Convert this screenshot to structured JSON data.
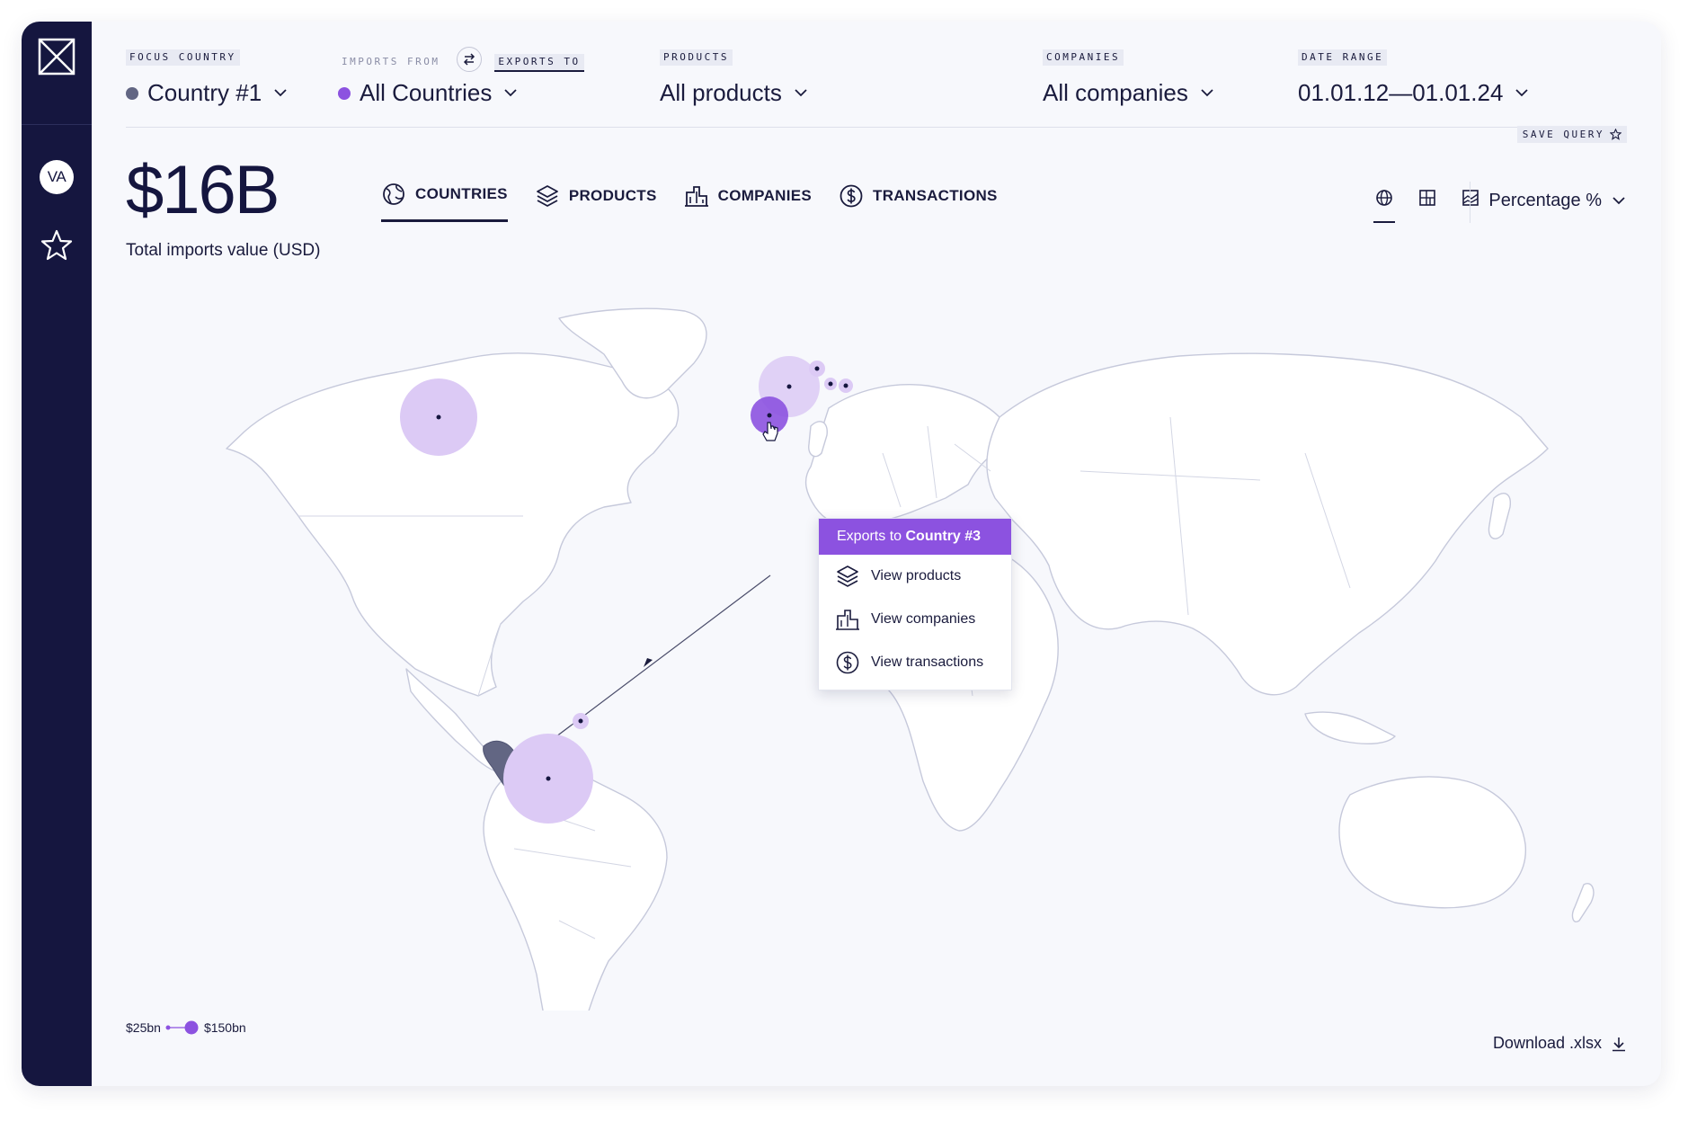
{
  "sidebar": {
    "logo_icon": "app-logo-icon",
    "avatar_initials": "VA",
    "favorites_icon": "star-icon"
  },
  "filters": {
    "focus_country": {
      "label": "FOCUS COUNTRY",
      "value": "Country #1",
      "dot_color": "#626683"
    },
    "direction": {
      "imports_label": "IMPORTS FROM",
      "exports_label": "EXPORTS TO",
      "active": "EXPORTS TO",
      "swap_icon": "swap-arrows-icon"
    },
    "partner": {
      "value": "All Countries",
      "dot_color": "#8c52e0"
    },
    "products": {
      "label": "PRODUCTS",
      "value": "All products"
    },
    "companies": {
      "label": "COMPANIES",
      "value": "All companies"
    },
    "date_range": {
      "label": "DATE RANGE",
      "value": "01.01.12—01.01.24"
    }
  },
  "save_query": "SAVE QUERY",
  "summary": {
    "value": "$16B",
    "caption": "Total imports value (USD)"
  },
  "tabs": [
    {
      "label": "COUNTRIES",
      "icon": "globe-icon",
      "active": true
    },
    {
      "label": "PRODUCTS",
      "icon": "layers-icon",
      "active": false
    },
    {
      "label": "COMPANIES",
      "icon": "building-icon",
      "active": false
    },
    {
      "label": "TRANSACTIONS",
      "icon": "dollar-circle-icon",
      "active": false
    }
  ],
  "view_modes": [
    {
      "icon": "globe-view-icon",
      "active": true
    },
    {
      "icon": "treemap-view-icon",
      "active": false
    },
    {
      "icon": "area-chart-view-icon",
      "active": false
    }
  ],
  "metric_select": "Percentage %",
  "tooltip": {
    "prefix": "Exports to ",
    "country": "Country #3",
    "items": [
      {
        "label": "View products",
        "icon": "layers-icon"
      },
      {
        "label": "View companies",
        "icon": "building-icon"
      },
      {
        "label": "View transactions",
        "icon": "dollar-circle-icon"
      }
    ]
  },
  "legend": {
    "min": "$25bn",
    "max": "$150bn"
  },
  "download": "Download .xlsx",
  "colors": {
    "navy": "#15163f",
    "purple": "#8c52e0",
    "bubble": "#dccaf5",
    "highlight": "#626683"
  }
}
